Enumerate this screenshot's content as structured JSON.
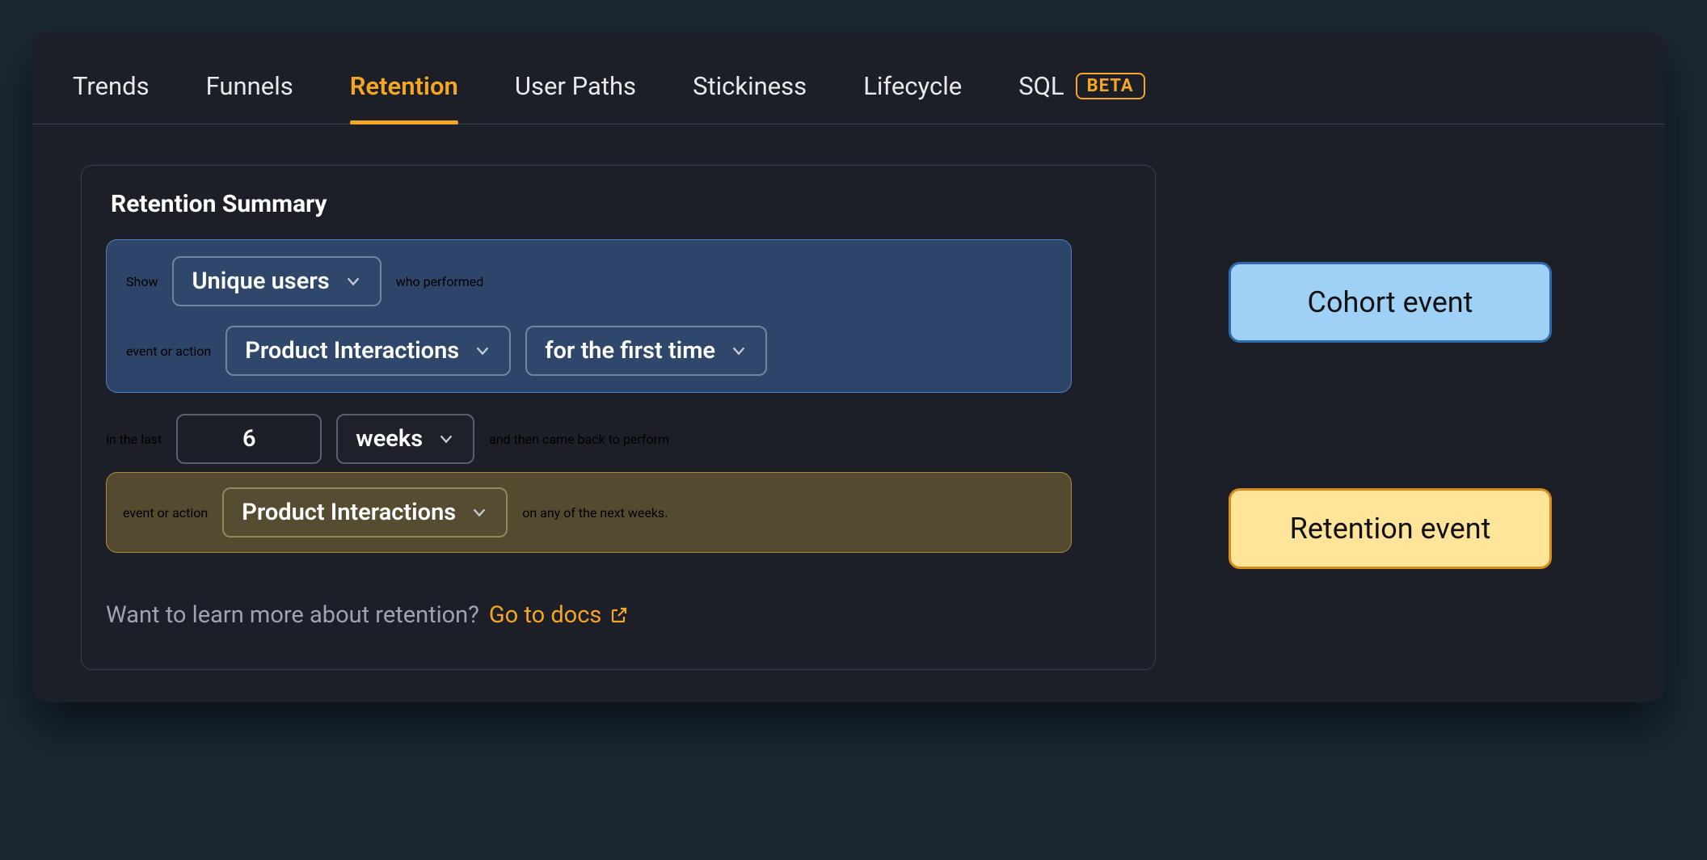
{
  "tabs": {
    "items": [
      "Trends",
      "Funnels",
      "Retention",
      "User Paths",
      "Stickiness",
      "Lifecycle"
    ],
    "sql_label": "SQL",
    "beta_badge": "BETA",
    "active_index": 2
  },
  "panel": {
    "title": "Retention Summary",
    "line1_show": "Show",
    "line1_who": "who performed",
    "line2_eventaction": "event or action",
    "period_prefix": "in the last",
    "period_suffix": "and then came back to perform",
    "line4_eventaction": "event or action",
    "line4_suffix": "on any of the next weeks.",
    "users_dd": "Unique users",
    "cohort_event_dd": "Product Interactions",
    "first_time_dd": "for the first time",
    "period_count": "6",
    "period_unit_dd": "weeks",
    "retention_event_dd": "Product Interactions"
  },
  "docs": {
    "question": "Want to learn more about retention?",
    "link_label": "Go to docs"
  },
  "callouts": {
    "cohort": "Cohort event",
    "retention": "Retention event"
  }
}
